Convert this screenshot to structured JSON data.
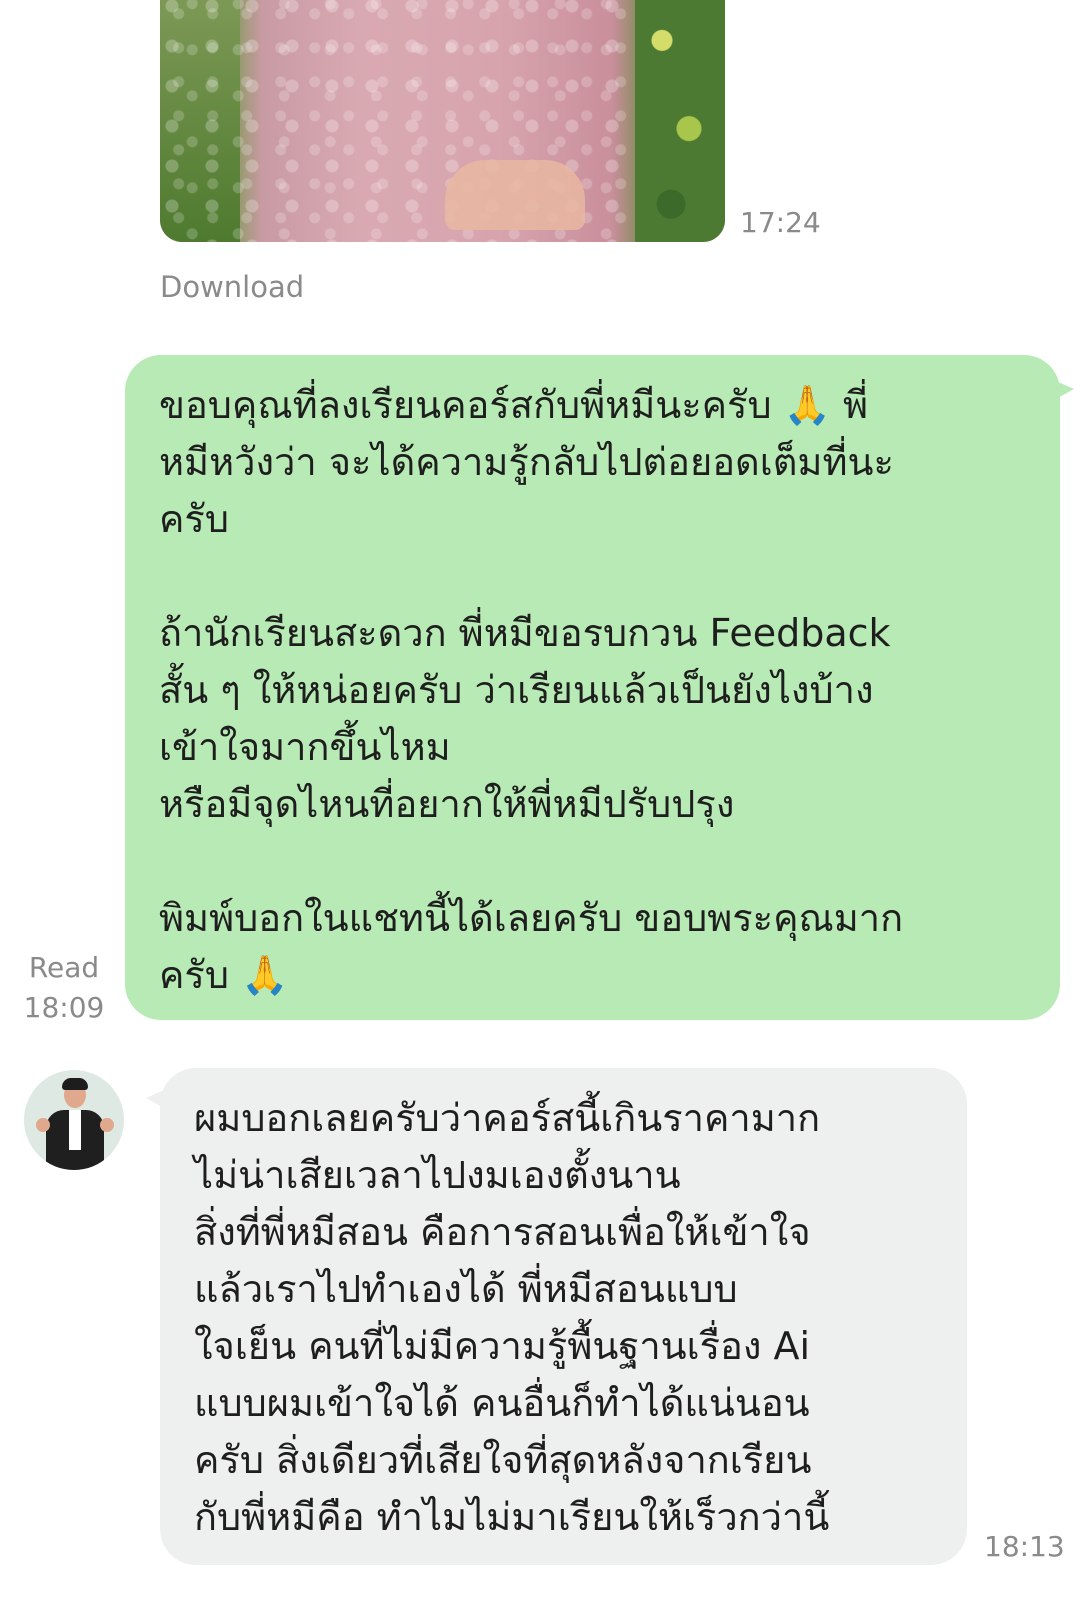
{
  "messages": [
    {
      "type": "image",
      "time": "17:24",
      "download_label": "Download"
    },
    {
      "type": "outgoing_text",
      "status": "Read",
      "time": "18:09",
      "text": "ขอบคุณที่ลงเรียนคอร์สกับพี่หมีนะครับ 🙏 พี่\nหมีหวังว่า จะได้ความรู้กลับไปต่อยอดเต็มที่นะ\nครับ\n\nถ้านักเรียนสะดวก พี่หมีขอรบกวน Feedback\nสั้น ๆ ให้หน่อยครับ ว่าเรียนแล้วเป็นยังไงบ้าง\nเข้าใจมากขึ้นไหม\nหรือมีจุดไหนที่อยากให้พี่หมีปรับปรุง\n\nพิมพ์บอกในแชทนี้ได้เลยครับ ขอบพระคุณมาก\nครับ 🙏"
    },
    {
      "type": "incoming_text",
      "time": "18:13",
      "text": "ผมบอกเลยครับว่าคอร์สนี้เกินราคามาก\nไม่น่าเสียเวลาไปงมเองตั้งนาน\nสิ่งที่พี่หมีสอน คือการสอนเพื่อให้เข้าใจ\nแล้วเราไปทำเองได้ พี่หมีสอนแบบ\nใจเย็น คนที่ไม่มีความรู้พื้นฐานเรื่อง Ai\nแบบผมเข้าใจได้ คนอื่นก็ทำได้แน่นอน\nครับ สิ่งเดียวที่เสียใจที่สุดหลังจากเรียน\nกับพี่หมีคือ ทำไมไม่มาเรียนให้เร็วกว่านี้"
    }
  ],
  "colors": {
    "outgoing_bubble": "#b7eab4",
    "incoming_bubble": "#eeefef",
    "meta_text": "#8a8a8a"
  }
}
